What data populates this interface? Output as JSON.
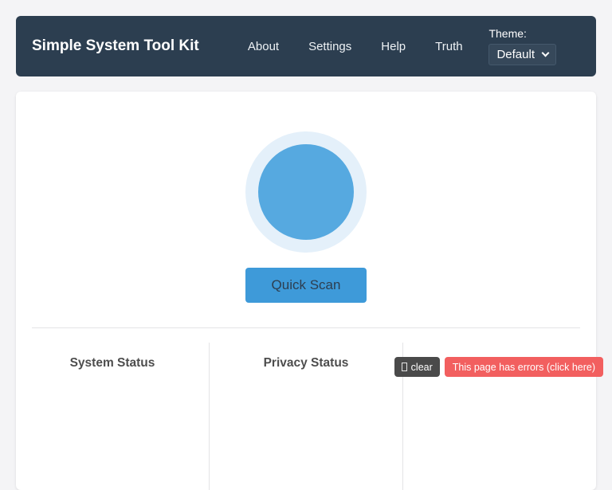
{
  "navbar": {
    "title": "Simple System Tool Kit",
    "links": [
      {
        "label": "About"
      },
      {
        "label": "Settings"
      },
      {
        "label": "Help"
      },
      {
        "label": "Truth"
      }
    ],
    "theme": {
      "label": "Theme:",
      "selected": "Default",
      "chevron_icon": "chevron-down-icon"
    }
  },
  "main": {
    "scan_circle_icon": "scan-status-circle",
    "quick_scan_label": "Quick Scan"
  },
  "footer": {
    "columns": [
      {
        "title": "System Status"
      },
      {
        "title": "Privacy Status"
      }
    ]
  },
  "overlay": {
    "clear_icon": "missing-glyph-box",
    "clear_label": "clear",
    "error_label": "This page has errors (click here)"
  },
  "colors": {
    "page_background": "#f4f4f6",
    "navbar_background": "#2c3e50",
    "card_background": "#ffffff",
    "scan_ring": "#e4f0fa",
    "scan_inner": "#56a9e0",
    "quick_scan_button": "#3e9ad9",
    "clear_button": "#4a4a4a",
    "error_badge": "#f25f5f"
  }
}
